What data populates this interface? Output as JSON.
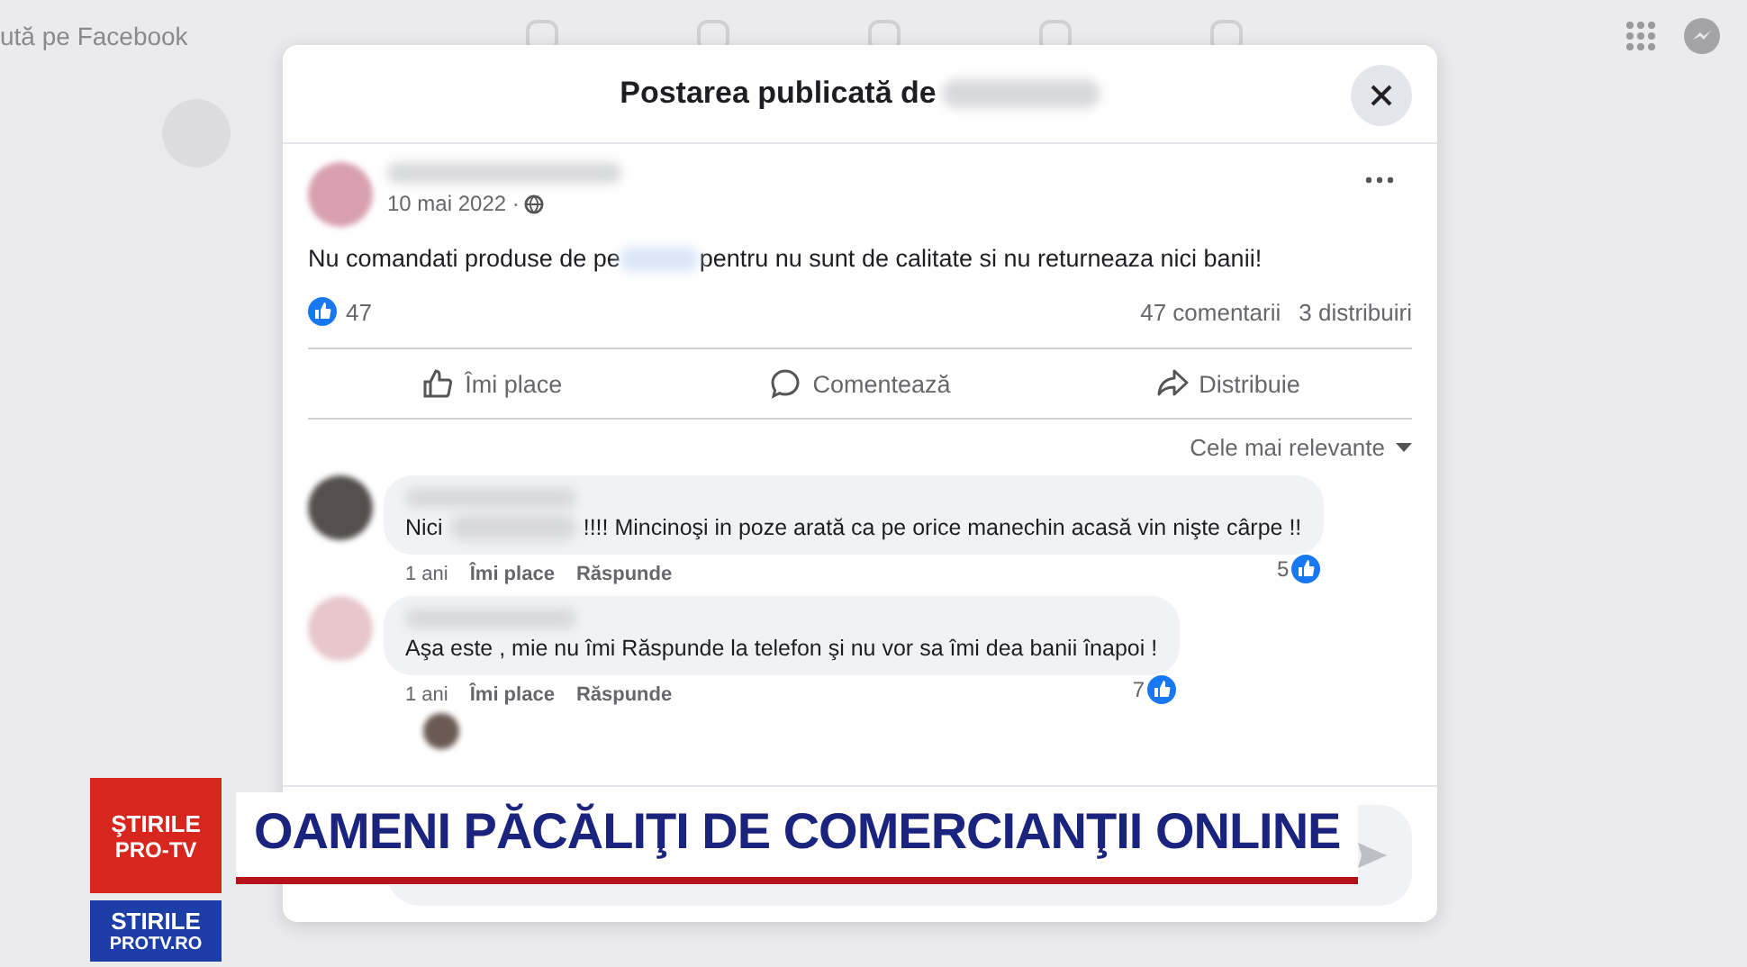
{
  "top_bar": {
    "search_text": "ută pe Facebook"
  },
  "dialog": {
    "title": "Postarea publicată de"
  },
  "post": {
    "date": "10 mai 2022 ·",
    "text_before": "Nu comandati produse de pe",
    "text_after": "pentru nu sunt de calitate si nu returneaza nici banii!",
    "likes": "47",
    "comments": "47 comentarii",
    "shares": "3 distribuiri"
  },
  "actions": [
    {
      "kind": "like",
      "label": "Îmi place"
    },
    {
      "kind": "comment",
      "label": "Comentează"
    },
    {
      "kind": "share",
      "label": "Distribuie"
    }
  ],
  "sort": "Cele mai relevante",
  "comments": [
    {
      "color": "#55504f",
      "text_before": "Nici",
      "text_after": "!!!! Mincinoşi in poze arată ca pe orice manechin acasă vin nişte cârpe !!",
      "time": "1 ani",
      "like": "Îmi place",
      "reply": "Răspunde",
      "reactions": "5"
    },
    {
      "color": "#e7c6cc",
      "text_before": "Aşa este , mie nu îmi Răspunde la telefon şi nu vor sa îmi dea banii înapoi !",
      "time": "1 ani",
      "like": "Îmi place",
      "reply": "Răspunde",
      "reactions": "7"
    }
  ],
  "banner": {
    "logo_top": [
      "ŞTIRILE",
      "PRO-TV"
    ],
    "logo_bottom": [
      "STIRILE",
      "PROTV.RO"
    ],
    "headline": "OAMENI PĂCĂLIŢI DE COMERCIANŢII ONLINE"
  }
}
